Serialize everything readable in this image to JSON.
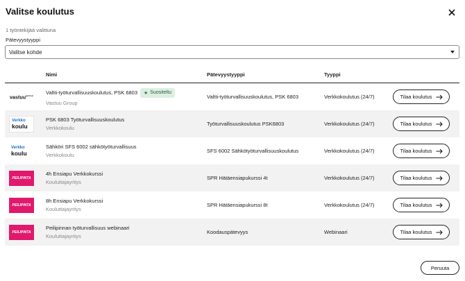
{
  "dialog": {
    "title": "Valitse koulutus",
    "selected_count": "1 työntekijää valittuna"
  },
  "filter": {
    "label": "Pätevyystyyppi",
    "selected_value": "Valitse kohde"
  },
  "table": {
    "headers": {
      "name": "Nimi",
      "certification_type": "Pätevyystyyppi",
      "type": "Tyyppi"
    },
    "rows": [
      {
        "logo": "vastuu-group-logo",
        "logo_text": "vastuu",
        "logo_sup": "group",
        "name": "Valtti-työturvallisuuskoulutus, PSK 6803",
        "badge": "Suositeltu",
        "provider": "Vastuu Group",
        "certification_type": "Valtti-työturvallisuuskoulutus, PSK 6803",
        "type": "Verkkokoulutus (24/7)",
        "action": "Tilaa koulutus"
      },
      {
        "logo": "verkkokoulu-logo",
        "logo_text_1": "Verkko",
        "logo_text_2": "koulu",
        "name": "PSK 6803 Työturvallisuuskoulutus",
        "provider": "Verkkokoulu",
        "certification_type": "Työturvallisuuskoulutus PSK6803",
        "type": "Verkkokoulutus (24/7)",
        "action": "Tilaa koulutus"
      },
      {
        "logo": "verkkokoulu-logo",
        "logo_text_1": "Verkko",
        "logo_text_2": "koulu",
        "name": "Sähköri SFS 6002 sähkötyöturvallisuus",
        "provider": "Verkkokoulu",
        "certification_type": "SFS 6002 Sähkötyöturvallisuuskoulutus",
        "type": "Verkkokoulutus (24/7)",
        "action": "Tilaa koulutus"
      },
      {
        "logo": "pelipinta-logo",
        "logo_text": "PEILIPINTA",
        "name": "4h Ensiapu Verkkokurssi",
        "provider": "Kouluttajayritys",
        "certification_type": "SPR Hätäensiapukurssi 4t",
        "type": "Verkkokoulutus (24/7)",
        "action": "Tilaa koulutus"
      },
      {
        "logo": "pelipinta-logo",
        "logo_text": "PEILIPINTA",
        "name": "8h Ensiapu Verkkokurssi",
        "provider": "Kouluttajayritys",
        "certification_type": "SPR Hätäensiapukurssi 8t",
        "type": "Verkkokoulutus (24/7)",
        "action": "Tilaa koulutus"
      },
      {
        "logo": "pelipinta-logo",
        "logo_text": "PEILIPINTA",
        "name": "Peilipinnan työturvallisuus webinaari",
        "provider": "Kouluttajayritys",
        "certification_type": "Koodauspätevyys",
        "type": "Webinaari",
        "action": "Tilaa koulutus"
      }
    ]
  },
  "footer": {
    "cancel_label": "Peruuta"
  },
  "colors": {
    "accent_pink": "#e0196d",
    "verkko_blue": "#1a72c9",
    "badge_bg": "#dcefe2",
    "row_alt_bg": "#f2f2f2"
  },
  "icons": {
    "close": "close-icon",
    "caret": "chevron-down-icon",
    "arrow": "arrow-right-icon",
    "star": "star-icon"
  }
}
